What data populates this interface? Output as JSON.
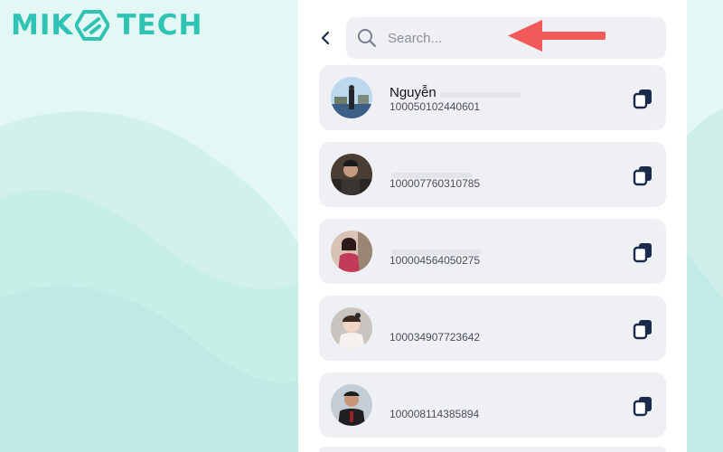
{
  "brand": {
    "logo_left": "MIK",
    "logo_right": "TECH"
  },
  "header": {
    "back_icon": "chevron-left-icon"
  },
  "search": {
    "placeholder": "Search...",
    "value": "",
    "icon": "search-icon"
  },
  "annotation": {
    "arrow_color": "#f25a5a"
  },
  "colors": {
    "accent": "#2fc3b4",
    "card": "#eef0f4",
    "copy_icon": "#1b2b4b"
  },
  "users": [
    {
      "name": "Nguyễn",
      "uid": "100050102440601"
    },
    {
      "name": "",
      "uid": "100007760310785"
    },
    {
      "name": "",
      "uid": "100004564050275"
    },
    {
      "name": "",
      "uid": "100034907723642"
    },
    {
      "name": "",
      "uid": "100008114385894"
    }
  ]
}
